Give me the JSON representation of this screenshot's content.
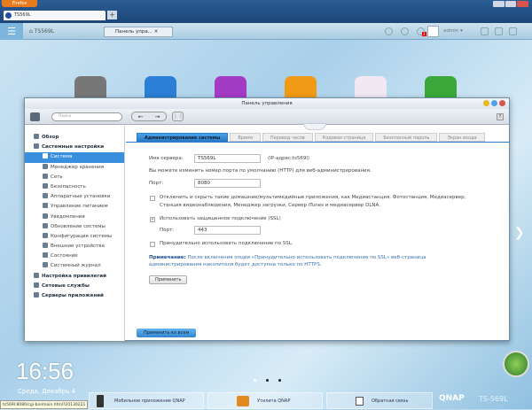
{
  "browser": {
    "menu_label": "Firefox",
    "tab_title": "TS569L",
    "new_tab": "+"
  },
  "topbar": {
    "home_label": "TS569L",
    "open_tab": "Панель упра...",
    "user": "admin",
    "notif_count": "3"
  },
  "window": {
    "title": "Панель управления",
    "search_placeholder": "Поиск",
    "help": "?",
    "sidebar": [
      {
        "label": "Обзор",
        "level": 0
      },
      {
        "label": "Системные настройки",
        "level": 0
      },
      {
        "label": "Система",
        "level": 1,
        "selected": true
      },
      {
        "label": "Менеджер хранения",
        "level": 1
      },
      {
        "label": "Сеть",
        "level": 1
      },
      {
        "label": "Безопасность",
        "level": 1
      },
      {
        "label": "Аппаратные установки",
        "level": 1
      },
      {
        "label": "Управление питанием",
        "level": 1
      },
      {
        "label": "Уведомления",
        "level": 1
      },
      {
        "label": "Обновление системы",
        "level": 1
      },
      {
        "label": "Конфигурация системы",
        "level": 1
      },
      {
        "label": "Внешние устройства",
        "level": 1
      },
      {
        "label": "Состояние",
        "level": 1
      },
      {
        "label": "Системный журнал",
        "level": 1
      },
      {
        "label": "Настройка привилегий",
        "level": 0
      },
      {
        "label": "Сетевые службы",
        "level": 0
      },
      {
        "label": "Серверы приложений",
        "level": 0
      }
    ],
    "tabs": [
      "Администрирование системы",
      "Время",
      "Перевод часов",
      "Кодовая страница",
      "Безопасный пароль",
      "Экран входа"
    ],
    "form": {
      "server_name_label": "Имя сервера:",
      "server_name": "TS569L",
      "ip_hint": "(IP-адрес:ts569l)",
      "port_info": "Вы можете изменить номер порта по умолчанию (HTTP) для веб-администрирования.",
      "port_label": "Порт:",
      "port": "8080",
      "disable_apps": "Отключить и скрыть такие домашние/мультимедийные приложения, как Медиастанция, Фотостанция, Медиасервер,",
      "disable_apps2": "Станция видеонаблюдения, Менеджер загрузки, Сервер iTunes и медиасервер DLNA.",
      "disable_apps_checked": false,
      "ssl_label": "Использовать защищенное подключение (SSL)",
      "ssl_checked": true,
      "ssl_port_label": "Порт:",
      "ssl_port": "443",
      "force_ssl": "Принудительно использовать подключение по SSL.",
      "force_ssl_checked": false,
      "note_title": "Примечание:",
      "note_text": "После включения опции «Принудительно использовать подключение по SSL» веб-страница",
      "note_text2": "администрирования накопителя будет доступна только по HTTPS.",
      "apply": "Применить"
    },
    "apply_all": "Применить ко всем"
  },
  "desktop": {
    "time": "16:56",
    "date": "Среда, Декабрь 4",
    "status_url": "ts569l:8080/cgi-bin/main.html?20130221",
    "dock": [
      "Мобильное приложение QNAP",
      "Утилита QNAP",
      "Обратная связь"
    ],
    "brand": "QNAP",
    "model": "TS-569L"
  }
}
